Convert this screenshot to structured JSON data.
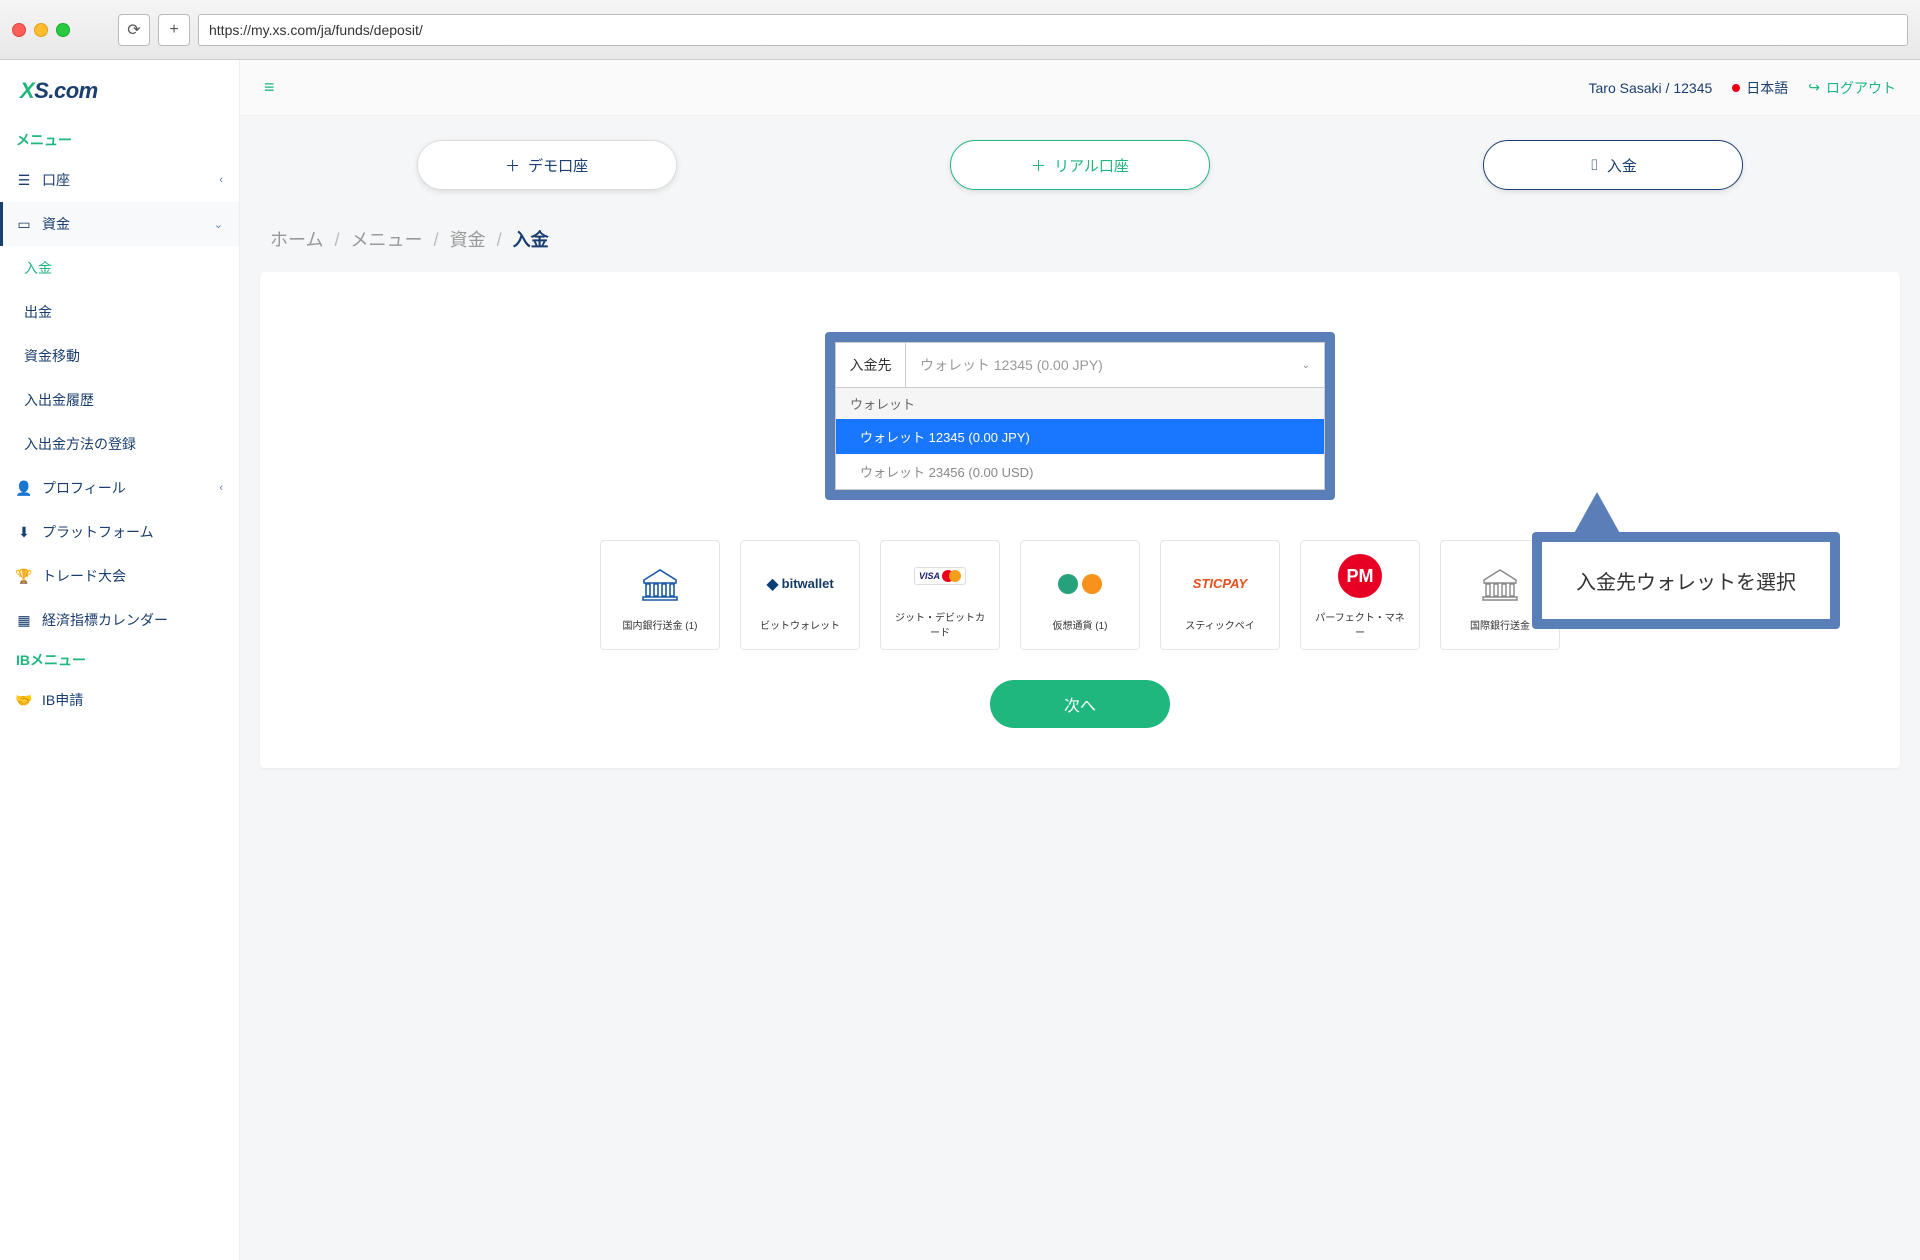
{
  "browser": {
    "url": "https://my.xs.com/ja/funds/deposit/"
  },
  "logo": {
    "x": "X",
    "s": "S",
    "com": ".com"
  },
  "sidebar": {
    "menu_header": "メニュー",
    "ib_header": "IBメニュー",
    "items": {
      "accounts": "口座",
      "funds": "資金",
      "profile": "プロフィール",
      "platform": "プラットフォーム",
      "contest": "トレード大会",
      "calendar": "経済指標カレンダー",
      "ib_apply": "IB申請"
    },
    "funds_sub": {
      "deposit": "入金",
      "withdraw": "出金",
      "transfer": "資金移動",
      "history": "入出金履歴",
      "register": "入出金方法の登録"
    }
  },
  "topbar": {
    "user": "Taro Sasaki / 12345",
    "language": "日本語",
    "logout": "ログアウト"
  },
  "actions": {
    "demo": "デモ口座",
    "real": "リアル口座",
    "deposit": "入金"
  },
  "breadcrumb": {
    "home": "ホーム",
    "menu": "メニュー",
    "funds": "資金",
    "deposit": "入金"
  },
  "deposit": {
    "label": "入金先",
    "placeholder": "ウォレット 12345 (0.00 JPY)",
    "group": "ウォレット",
    "options": [
      "ウォレット 12345 (0.00 JPY)",
      "ウォレット 23456 (0.00 USD)"
    ]
  },
  "payments": {
    "bank": "国内銀行送金 (1)",
    "bitwallet": "ビットウォレット",
    "card": "ジット・デビットカード",
    "crypto": "仮想通貨 (1)",
    "sticpay": "スティックペイ",
    "perfectmoney": "パーフェクト・マネー",
    "intlbank": "国際銀行送金"
  },
  "brand": {
    "sticpay": "STICPAY",
    "pm": "PM",
    "bitwallet": "bitwallet",
    "visa": "VISA"
  },
  "callout": "入金先ウォレットを選択",
  "next": "次へ"
}
